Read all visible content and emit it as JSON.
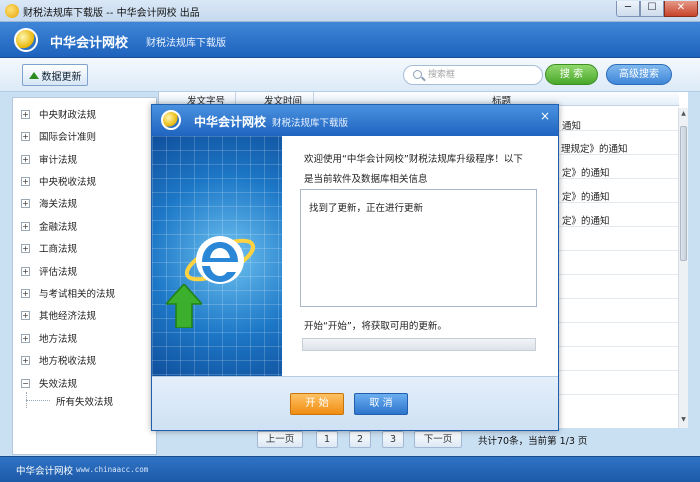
{
  "window": {
    "title": "财税法规库下载版 -- 中华会计网校 出品",
    "min_label": "─",
    "max_label": "☐",
    "close_label": "✕"
  },
  "header": {
    "brand": "中华会计网校",
    "subtitle": "财税法规库下载版"
  },
  "toolbar": {
    "update_label": "数据更新",
    "search_placeholder": "搜索框",
    "search_label": "搜 索",
    "advanced_label": "高级搜索"
  },
  "sidebar": {
    "items": [
      {
        "toggle": "+",
        "label": "中央财政法规"
      },
      {
        "toggle": "+",
        "label": "国际会计准则"
      },
      {
        "toggle": "+",
        "label": "审计法规"
      },
      {
        "toggle": "+",
        "label": "中央税收法规"
      },
      {
        "toggle": "+",
        "label": "海关法规"
      },
      {
        "toggle": "+",
        "label": "金融法规"
      },
      {
        "toggle": "+",
        "label": "工商法规"
      },
      {
        "toggle": "+",
        "label": "评估法规"
      },
      {
        "toggle": "+",
        "label": "与考试相关的法规"
      },
      {
        "toggle": "+",
        "label": "其他经济法规"
      },
      {
        "toggle": "+",
        "label": "地方法规"
      },
      {
        "toggle": "+",
        "label": "地方税收法规"
      },
      {
        "toggle": "−",
        "label": "失效法规"
      }
    ],
    "child": "所有失效法规"
  },
  "table": {
    "columns": [
      "发文字号",
      "发文时间",
      "标题"
    ],
    "rows": [
      {
        "title_tail": "通知"
      },
      {
        "title_tail": "理规定》的通知"
      },
      {
        "title_tail": "定》的通知"
      },
      {
        "title_tail": "定》的通知"
      },
      {
        "title_tail": "定》的通知"
      }
    ]
  },
  "pager": {
    "prev": "上一页",
    "pages": [
      "1",
      "2",
      "3"
    ],
    "next": "下一页",
    "info": "共计70条，当前第 1/3 页"
  },
  "status": {
    "brand": "中华会计网校",
    "url": "www.chinaacc.com"
  },
  "dialog": {
    "brand": "中华会计网校",
    "subtitle": "财税法规库下载版",
    "close_label": "×",
    "welcome_line1": "欢迎使用“中华会计网校”财税法规库升级程序！以下",
    "welcome_line2": "是当前软件及数据库相关信息",
    "status_text": "找到了更新，正在进行更新",
    "hint": "开始“开始”，将获取可用的更新。",
    "progress": 0,
    "start_label": "开 始",
    "cancel_label": "取 消"
  },
  "colors": {
    "header_blue": "#1e62bd",
    "search_green": "#4aa72a",
    "start_orange": "#ef8d12"
  }
}
